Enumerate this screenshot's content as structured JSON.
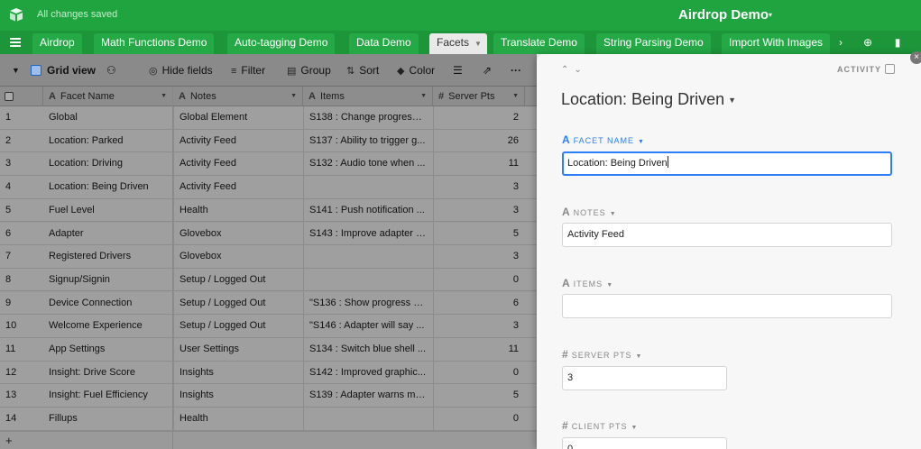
{
  "header": {
    "save_status": "All changes saved",
    "base_name": "Airdrop Demo",
    "base_caret": "▾"
  },
  "tabs": [
    {
      "label": "Airdrop"
    },
    {
      "label": "Math Functions Demo"
    },
    {
      "label": "Auto-tagging Demo"
    },
    {
      "label": "Data Demo"
    },
    {
      "label": "Facets",
      "active": true
    },
    {
      "label": "Translate Demo"
    },
    {
      "label": "String Parsing Demo"
    },
    {
      "label": "Import With Images"
    }
  ],
  "toolbar": {
    "view_name": "Grid view",
    "hide_fields": "Hide fields",
    "filter": "Filter",
    "group": "Group",
    "sort": "Sort",
    "color": "Color"
  },
  "table": {
    "columns": [
      "Facet Name",
      "Notes",
      "Items",
      "Server Pts"
    ],
    "rows": [
      {
        "n": "1",
        "name": "Global",
        "notes": "Global Element",
        "items": "S138 : Change progress ...",
        "pts": "2"
      },
      {
        "n": "2",
        "name": "Location: Parked",
        "notes": "Activity Feed",
        "items": "S137 : Ability to trigger g...",
        "pts": "26"
      },
      {
        "n": "3",
        "name": "Location: Driving",
        "notes": "Activity Feed",
        "items": "S132 : Audio tone when ...",
        "pts": "11"
      },
      {
        "n": "4",
        "name": "Location: Being Driven",
        "notes": "Activity Feed",
        "items": "",
        "pts": "3"
      },
      {
        "n": "5",
        "name": "Fuel Level",
        "notes": "Health",
        "items": "S141 : Push notification ...",
        "pts": "3"
      },
      {
        "n": "6",
        "name": "Adapter",
        "notes": "Glovebox",
        "items": "S143 : Improve adapter s...",
        "pts": "5"
      },
      {
        "n": "7",
        "name": "Registered Drivers",
        "notes": "Glovebox",
        "items": "",
        "pts": "3"
      },
      {
        "n": "8",
        "name": "Signup/Signin",
        "notes": "Setup / Logged Out",
        "items": "",
        "pts": "0"
      },
      {
        "n": "9",
        "name": "Device Connection",
        "notes": "Setup / Logged Out",
        "items": "\"S136 : Show progress b...",
        "pts": "6"
      },
      {
        "n": "10",
        "name": "Welcome Experience",
        "notes": "Setup / Logged Out",
        "items": "\"S146 : Adapter will say ...",
        "pts": "3"
      },
      {
        "n": "11",
        "name": "App Settings",
        "notes": "User Settings",
        "items": "S134 : Switch blue shell ...",
        "pts": "11"
      },
      {
        "n": "12",
        "name": "Insight: Drive Score",
        "notes": "Insights",
        "items": "S142 : Improved graphic...",
        "pts": "0"
      },
      {
        "n": "13",
        "name": "Insight: Fuel Efficiency",
        "notes": "Insights",
        "items": "S139 : Adapter warns me...",
        "pts": "5"
      },
      {
        "n": "14",
        "name": "Fillups",
        "notes": "Health",
        "items": "",
        "pts": "0"
      }
    ],
    "add_row": "+"
  },
  "panel": {
    "activity": "ACTIVITY",
    "record_title": "Location: Being Driven",
    "fields": {
      "facet_name": {
        "label": "FACET NAME",
        "value": "Location: Being Driven"
      },
      "notes": {
        "label": "NOTES",
        "value": "Activity Feed"
      },
      "items": {
        "label": "ITEMS",
        "value": ""
      },
      "server_pts": {
        "label": "SERVER PTS",
        "value": "3"
      },
      "client_pts": {
        "label": "CLIENT PTS",
        "value": "0"
      }
    }
  },
  "colors": {
    "topbar": "#20a43f",
    "tabbar": "#1d963a",
    "focus": "#2d7ff9",
    "grid_view_icon": "#1f63c4"
  }
}
